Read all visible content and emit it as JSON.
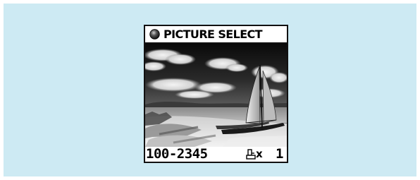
{
  "screen": {
    "title": "PICTURE SELECT",
    "title_icon": "filled-circle-bullet-icon",
    "photo": "beach-sailboat-photo"
  },
  "status": {
    "frame_number": "100-2345",
    "print_icon": "print-order-icon",
    "times": "x",
    "print_count": "1"
  },
  "colors": {
    "background": "#cdeaf3",
    "lcd_border": "#111111",
    "text": "#000000"
  }
}
